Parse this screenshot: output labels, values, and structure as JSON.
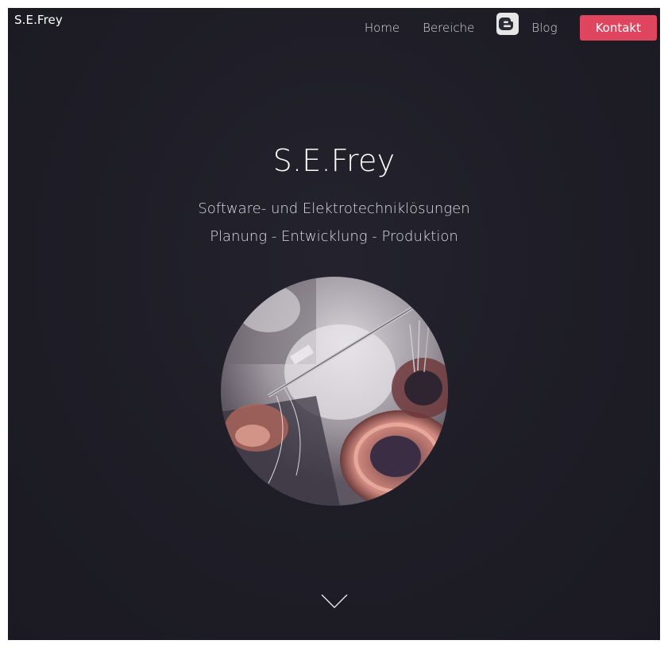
{
  "header": {
    "brand": "S.E.Frey",
    "nav": {
      "home": "Home",
      "bereiche": "Bereiche",
      "blog": "Blog",
      "kontakt": "Kontakt"
    }
  },
  "hero": {
    "title": "S.E.Frey",
    "subtitle_1": "Software- und Elektrotechniklösungen",
    "subtitle_2": "Planung - Entwicklung - Produktion"
  },
  "icons": {
    "blog": "blogger-icon",
    "scroll": "chevron-down-icon"
  },
  "colors": {
    "background": "#1e1d26",
    "accent": "#e0455f",
    "text": "#ffffff"
  }
}
